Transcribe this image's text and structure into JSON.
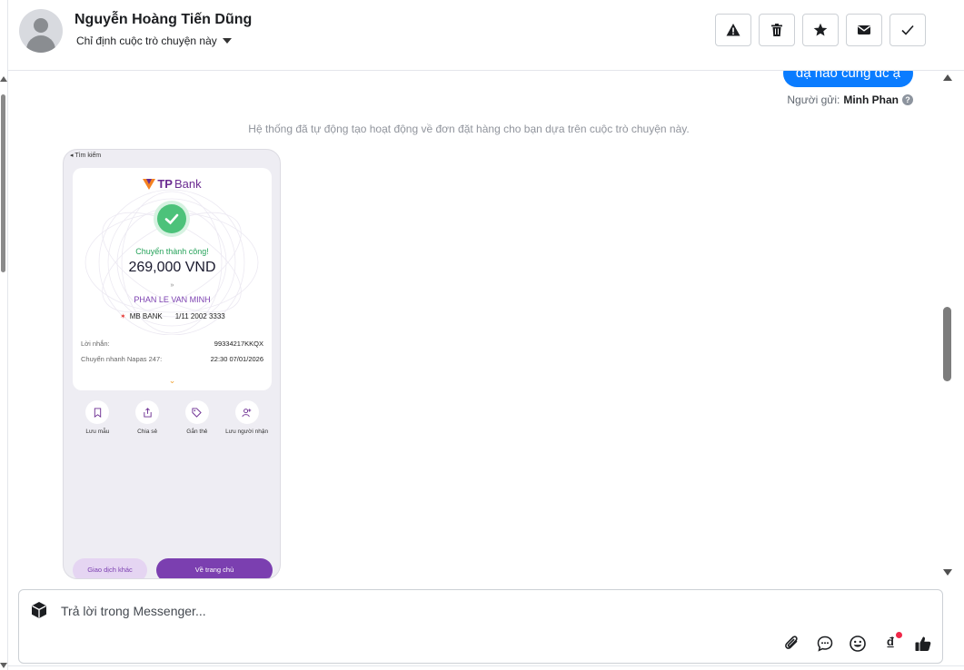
{
  "header": {
    "contact_name": "Nguyễn Hoàng Tiến Dũng",
    "assign_label": "Chỉ định cuộc trò chuyện này",
    "actions": [
      "alert-icon",
      "trash-icon",
      "star-icon",
      "envelope-icon",
      "check-icon"
    ]
  },
  "conversation": {
    "last_message": "dạ hao cũng dc ạ",
    "sender_prefix": "Người gửi:",
    "sender_name": "Minh Phan",
    "help_glyph": "?",
    "system_note": "Hệ thống đã tự động tạo hoạt động về đơn đặt hàng cho bạn dựa trên cuộc trò chuyện này."
  },
  "receipt": {
    "back_label": "◂ Tìm kiếm",
    "logo_tp": "TP",
    "logo_bank": "Bank",
    "status": "Chuyển thành công!",
    "amount": "269,000 VND",
    "chevrons": "»",
    "recipient": "PHAN LE VAN MINH",
    "bank_star": "✶",
    "bank_name": "MB BANK",
    "account": "1/11 2002 3333",
    "message_label": "Lời nhắn:",
    "message_value": "99334217KKQX",
    "transfer_label": "Chuyển nhanh Napas 247:",
    "transfer_value": "22:30 07/01/2026",
    "more_glyph": "⌄",
    "icons": [
      {
        "label": "Lưu mẫu",
        "icon": "bookmark-icon"
      },
      {
        "label": "Chia sẻ",
        "icon": "share-icon"
      },
      {
        "label": "Gắn thẻ",
        "icon": "tag-icon"
      },
      {
        "label": "Lưu người nhận",
        "icon": "add-contact-icon"
      }
    ],
    "btn_other": "Giao dịch khác",
    "btn_home": "Về trang chủ"
  },
  "composer": {
    "placeholder": "Trả lời trong Messenger...",
    "currency_glyph": "₫",
    "tools": [
      "paperclip-icon",
      "chat-bubble-icon",
      "emoji-icon",
      "dong-icon",
      "thumbs-up-icon"
    ]
  },
  "colors": {
    "bubble": "#0a7cff",
    "accent_purple": "#7b3fb0",
    "success_green": "#27a35b"
  }
}
